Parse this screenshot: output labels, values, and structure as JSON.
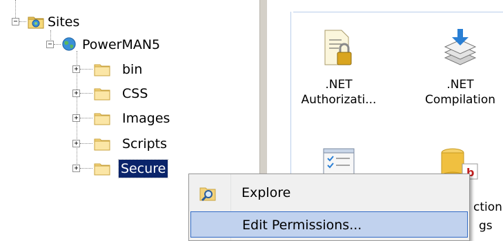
{
  "tree": {
    "root_label": "Sites",
    "site_label": "PowerMAN5",
    "folders": [
      {
        "label": "bin"
      },
      {
        "label": "CSS"
      },
      {
        "label": "Images"
      },
      {
        "label": "Scripts"
      },
      {
        "label": "Secure"
      }
    ],
    "collapse_glyph": "−",
    "expand_glyph": "+"
  },
  "features": [
    {
      "line1": ".NET",
      "line2": "Authorizati...",
      "icon": "net-authorization-icon"
    },
    {
      "line1": ".NET",
      "line2": "Compilation",
      "icon": "net-compilation-icon"
    },
    {
      "line1": "",
      "line2": "",
      "icon": "checklist-icon"
    },
    {
      "line1": "",
      "line2": "ction",
      "line3": "gs",
      "icon": "connection-strings-icon"
    }
  ],
  "context_menu": {
    "items": [
      {
        "label": "Explore",
        "icon": "explore-icon"
      },
      {
        "label": "Edit Permissions..."
      }
    ]
  },
  "colors": {
    "selection": "#0a246a",
    "menu_hover": "#c1d2ee",
    "menu_border": "#316ac5"
  }
}
